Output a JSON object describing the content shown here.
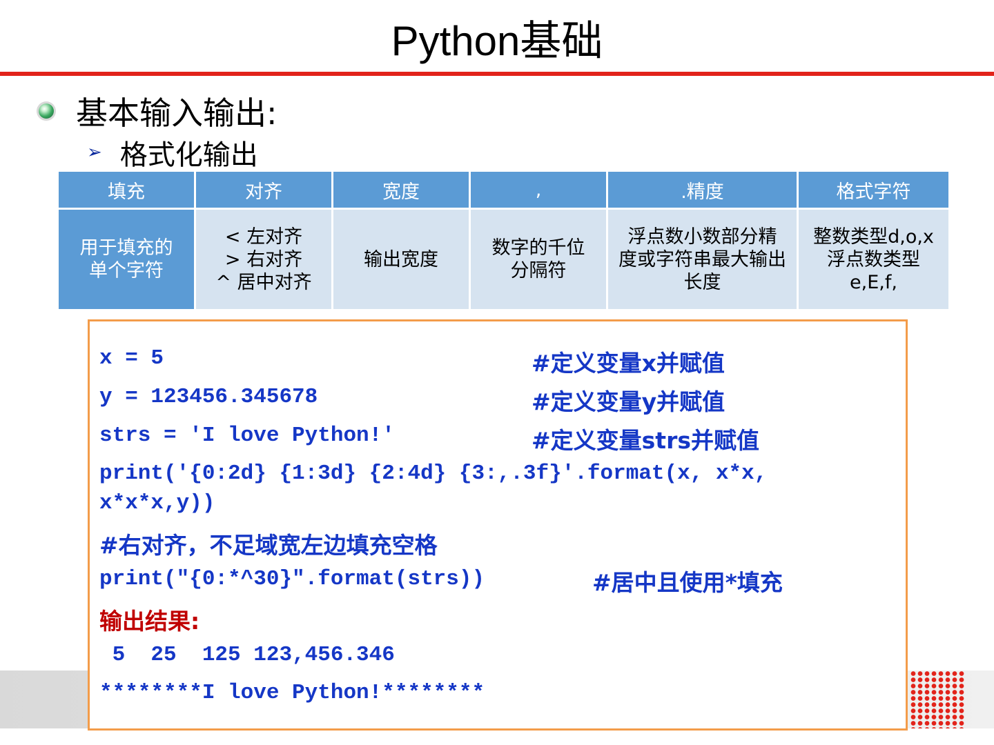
{
  "title": "Python基础",
  "bullet1": "基本输入输出:",
  "bullet2": "格式化输出",
  "table": {
    "headers": [
      "填充",
      "对齐",
      "宽度",
      ",",
      ".精度",
      "格式字符"
    ],
    "cells": [
      "用于填充的\n单个字符",
      "< 左对齐\n> 右对齐\n^ 居中对齐",
      "输出宽度",
      "数字的千位\n分隔符",
      "浮点数小数部分精\n度或字符串最大输出\n长度",
      "整数类型d,o,x\n浮点数类型\ne,E,f,"
    ]
  },
  "code": {
    "line1": "x = 5",
    "comment1": "#定义变量x并赋值",
    "line2": "y = 123456.345678",
    "comment2": "#定义变量y并赋值",
    "line3": "strs = 'I love Python!'",
    "comment3": "#定义变量strs并赋值",
    "line4a": "print('{0:2d} {1:3d} {2:4d} {3:,.3f}'.format(x, x*x,",
    "line4b": "x*x*x,y))",
    "comment4": "#右对齐，不足域宽左边填充空格",
    "line5": "print(\"{0:*^30}\".format(strs))",
    "comment5": "#居中且使用*填充",
    "result_label": "输出结果:",
    "output1": " 5  25  125 123,456.346",
    "output2": "********I love Python!********"
  }
}
